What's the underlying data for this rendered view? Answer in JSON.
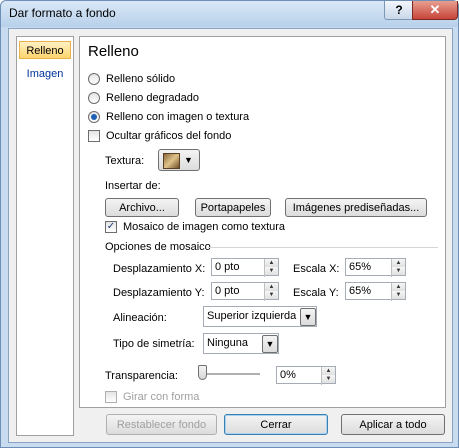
{
  "window": {
    "title": "Dar formato a fondo",
    "help_label": "?",
    "close_label": "✕"
  },
  "sidebar": {
    "items": [
      {
        "label": "Relleno",
        "active": true
      },
      {
        "label": "Imagen",
        "active": false
      }
    ]
  },
  "panel": {
    "heading": "Relleno",
    "fill_options": [
      {
        "label": "Relleno sólido",
        "selected": false
      },
      {
        "label": "Relleno degradado",
        "selected": false
      },
      {
        "label": "Relleno con imagen o textura",
        "selected": true
      }
    ],
    "hide_graphics": {
      "label": "Ocultar gráficos del fondo",
      "checked": false
    },
    "texture": {
      "label": "Textura:"
    },
    "insert_from": {
      "label": "Insertar de:",
      "buttons": {
        "file": "Archivo...",
        "clipboard": "Portapapeles",
        "clipart": "Imágenes prediseñadas..."
      }
    },
    "tile": {
      "label": "Mosaico de imagen como textura",
      "checked": true
    },
    "tile_options": {
      "label": "Opciones de mosaico",
      "offset_x": {
        "label": "Desplazamiento X:",
        "value": "0 pto"
      },
      "scale_x": {
        "label": "Escala X:",
        "value": "65%"
      },
      "offset_y": {
        "label": "Desplazamiento Y:",
        "value": "0 pto"
      },
      "scale_y": {
        "label": "Escala Y:",
        "value": "65%"
      },
      "alignment": {
        "label": "Alineación:",
        "value": "Superior izquierda"
      },
      "mirror": {
        "label": "Tipo de simetría:",
        "value": "Ninguna"
      }
    },
    "transparency": {
      "label": "Transparencia:",
      "value": "0%",
      "level": 0
    },
    "rotate": {
      "label": "Girar con forma",
      "checked": false,
      "enabled": false
    }
  },
  "footer": {
    "reset": "Restablecer fondo",
    "close": "Cerrar",
    "apply_all": "Aplicar a todo"
  }
}
